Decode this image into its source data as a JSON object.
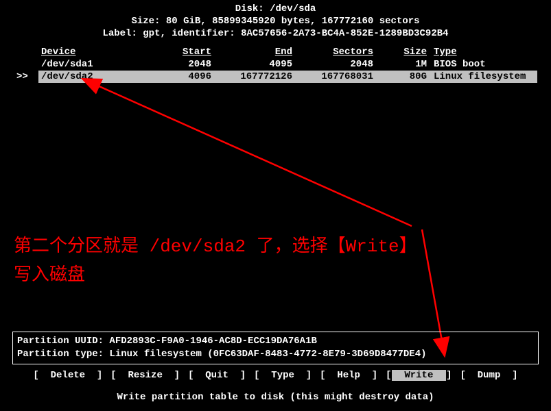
{
  "header": {
    "disk_line": "Disk: /dev/sda",
    "size_line": "Size: 80 GiB, 85899345920 bytes, 167772160 sectors",
    "label_line": "Label: gpt, identifier: 8AC57656-2A73-BC4A-852E-1289BD3C92B4"
  },
  "columns": {
    "device": "Device",
    "start": "Start",
    "end": "End",
    "sectors": "Sectors",
    "size": "Size",
    "type": "Type"
  },
  "rows": [
    {
      "selector": "",
      "device": "/dev/sda1",
      "start": "2048",
      "end": "4095",
      "sectors": "2048",
      "size": "1M",
      "type": "BIOS boot",
      "selected": false
    },
    {
      "selector": ">>",
      "device": "/dev/sda2",
      "start": "4096",
      "end": "167772126",
      "sectors": "167768031",
      "size": "80G",
      "type": "Linux filesystem",
      "selected": true
    }
  ],
  "annotation": {
    "text": "第二个分区就是 /dev/sda2 了，选择【Write】\n写入磁盘"
  },
  "info": {
    "line1": "Partition UUID: AFD2893C-F9A0-1946-AC8D-ECC19DA76A1B",
    "line2": "Partition type: Linux filesystem (0FC63DAF-8483-4772-8E79-3D69D8477DE4)"
  },
  "menu": {
    "items": [
      {
        "label": "Delete",
        "highlight": false
      },
      {
        "label": "Resize",
        "highlight": false
      },
      {
        "label": "Quit",
        "highlight": false
      },
      {
        "label": "Type",
        "highlight": false
      },
      {
        "label": "Help",
        "highlight": false
      },
      {
        "label": "Write",
        "highlight": true
      },
      {
        "label": "Dump",
        "highlight": false
      }
    ]
  },
  "footer": {
    "text": "Write partition table to disk (this might destroy data)"
  }
}
